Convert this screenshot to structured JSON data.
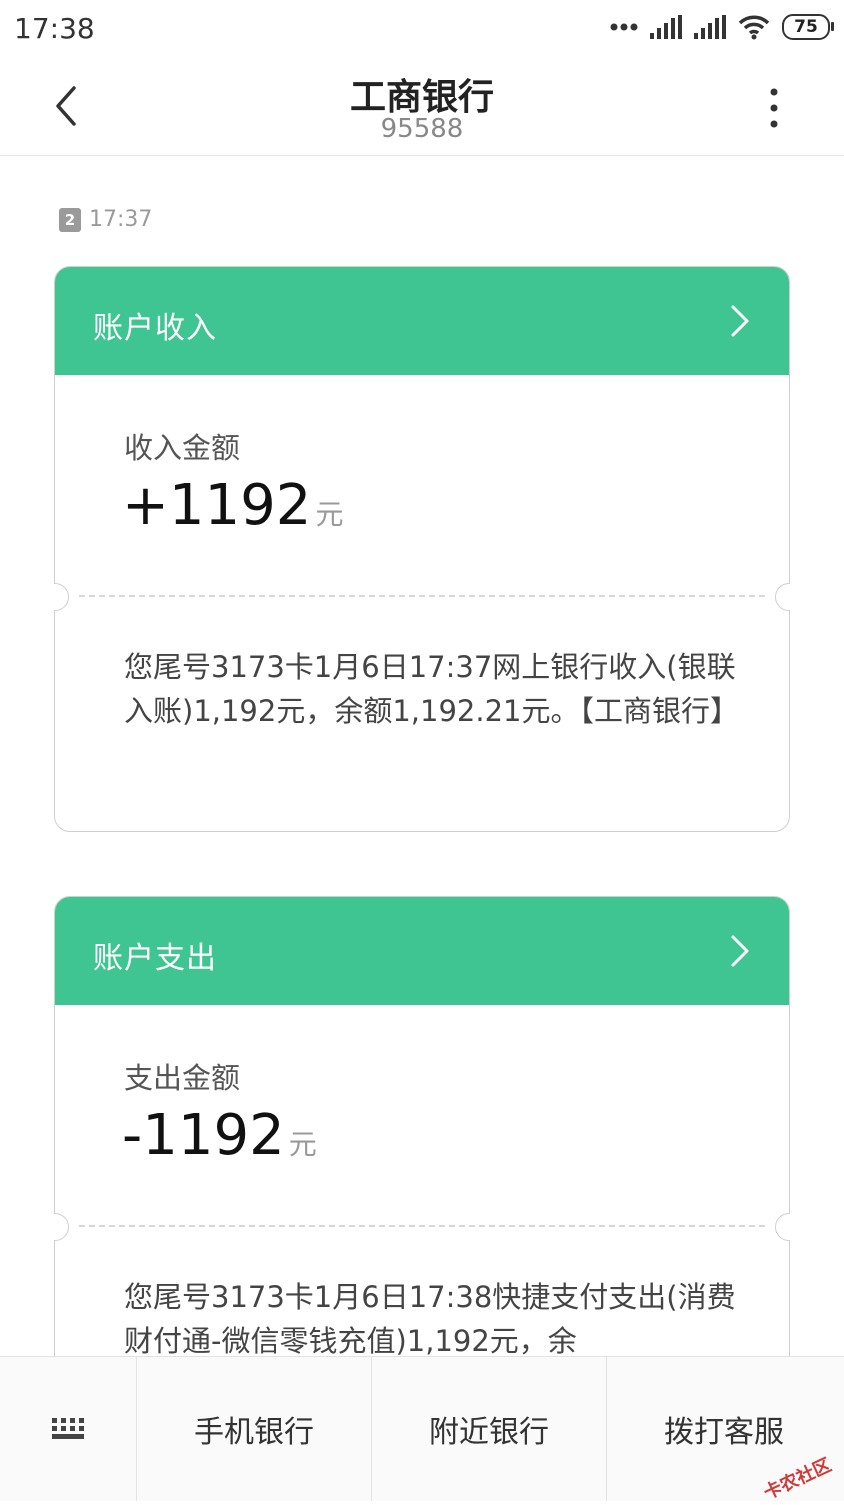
{
  "status_bar": {
    "time": "17:38",
    "battery": "75"
  },
  "header": {
    "title": "工商银行",
    "number": "95588"
  },
  "message": {
    "sim": "2",
    "time": "17:37"
  },
  "cards": [
    {
      "header": "账户收入",
      "amount_label": "收入金额",
      "amount": "+1192",
      "unit": "元",
      "body": "您尾号3173卡1月6日17:37网上银行收入(银联入账)1,192元，余额1,192.21元。【工商银行】"
    },
    {
      "header": "账户支出",
      "amount_label": "支出金额",
      "amount": "-1192",
      "unit": "元",
      "body": "您尾号3173卡1月6日17:38快捷支付支出(消费财付通-微信零钱充值)1,192元，余"
    }
  ],
  "bottom_bar": {
    "items": [
      "手机银行",
      "附近银行",
      "拨打客服"
    ]
  },
  "watermark": "卡农社区",
  "colors": {
    "accent": "#3ec592",
    "watermark": "#d03a3a"
  }
}
